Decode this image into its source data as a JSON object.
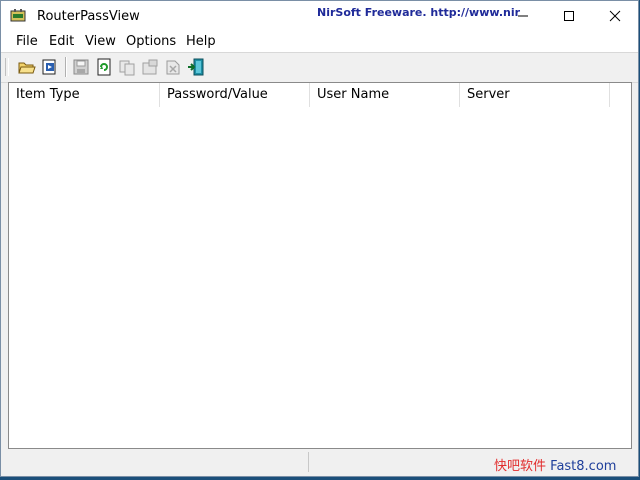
{
  "window": {
    "title": "RouterPassView"
  },
  "menu": [
    "File",
    "Edit",
    "View",
    "Options",
    "Help"
  ],
  "toolbar": {
    "icons": [
      "open-folder-icon",
      "open-file-icon",
      "save-icon",
      "refresh-icon",
      "copy-icon",
      "properties-icon",
      "html-report-icon",
      "exit-icon"
    ]
  },
  "table": {
    "columns": [
      "Item Type",
      "Password/Value",
      "User Name",
      "Server"
    ],
    "rows": []
  },
  "status": {
    "text": "NirSoft Freeware.  http://www.nir",
    "watermark_cn": "快吧软件",
    "watermark_site": "Fast8.com"
  },
  "colors": {
    "status_link": "#1f2a99",
    "watermark_red": "#e22d2d",
    "watermark_blue": "#1f3f9b"
  }
}
